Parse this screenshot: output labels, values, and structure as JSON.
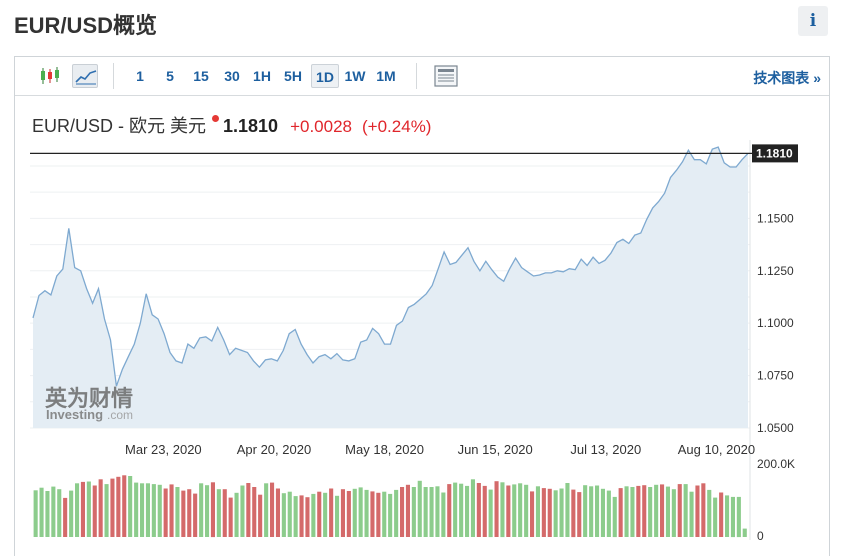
{
  "page": {
    "title": "EUR/USD概览",
    "info_icon": "i"
  },
  "toolbar": {
    "chart_type_icons": [
      "candlestick-icon",
      "line-chart-icon"
    ],
    "timeframes": [
      "1",
      "5",
      "15",
      "30",
      "1H",
      "5H",
      "1D",
      "1W",
      "1M"
    ],
    "active_timeframe": "1D",
    "layout_icon": "layout-icon",
    "tech_link": "技术图表 »"
  },
  "quote": {
    "symbol": "EUR/USD - 欧元 美元",
    "price": "1.1810",
    "change": "+0.0028",
    "change_pct": "(+0.24%)",
    "color_down": "#e0262b"
  },
  "watermark": {
    "cn": "英为财情",
    "en": "Investing",
    "suffix": ".com"
  },
  "chart_data": {
    "type": "area",
    "x_tick_labels": [
      "Mar 23, 2020",
      "Apr 20, 2020",
      "May 18, 2020",
      "Jun 15, 2020",
      "Jul 13, 2020",
      "Aug 10, 2020"
    ],
    "y_tick_labels": [
      "1.1500",
      "1.1250",
      "1.1000",
      "1.0750",
      "1.0500"
    ],
    "ylim": [
      1.05,
      1.185
    ],
    "last_price_label": "1.1810",
    "series_values": [
      1.1025,
      1.1132,
      1.1155,
      1.1135,
      1.1225,
      1.1258,
      1.1452,
      1.1265,
      1.125,
      1.1165,
      1.1095,
      1.1165,
      1.102,
      1.092,
      1.07,
      1.078,
      1.084,
      1.09,
      1.1,
      1.114,
      1.104,
      1.102,
      1.095,
      1.086,
      1.082,
      1.081,
      1.09,
      1.088,
      1.093,
      1.0935,
      1.0915,
      1.098,
      1.092,
      1.085,
      1.088,
      1.087,
      1.086,
      1.082,
      1.079,
      1.0825,
      1.083,
      1.082,
      1.087,
      1.095,
      1.097,
      1.09,
      1.085,
      1.081,
      1.084,
      1.085,
      1.083,
      1.0855,
      1.0825,
      1.082,
      1.083,
      1.091,
      1.092,
      1.0975,
      1.095,
      1.09,
      1.09,
      1.099,
      1.101,
      1.1075,
      1.109,
      1.1115,
      1.114,
      1.118,
      1.126,
      1.134,
      1.128,
      1.129,
      1.1325,
      1.136,
      1.1295,
      1.125,
      1.1295,
      1.1255,
      1.122,
      1.12,
      1.126,
      1.131,
      1.1265,
      1.1245,
      1.1225,
      1.123,
      1.124,
      1.124,
      1.125,
      1.1245,
      1.126,
      1.1255,
      1.1305,
      1.1275,
      1.1315,
      1.1285,
      1.13,
      1.1335,
      1.1385,
      1.14,
      1.138,
      1.142,
      1.143,
      1.1495,
      1.155,
      1.158,
      1.162,
      1.1695,
      1.173,
      1.177,
      1.1825,
      1.178,
      1.178,
      1.176,
      1.183,
      1.184,
      1.1765,
      1.1745,
      1.1745,
      1.178,
      1.181
    ],
    "volume_label": "200.0K",
    "volume_zero_label": "0",
    "volume_max": 200000,
    "volume_values": [
      128000,
      135000,
      126000,
      138000,
      131000,
      107000,
      127000,
      147000,
      151000,
      152000,
      141000,
      158000,
      145000,
      160000,
      165000,
      169000,
      167000,
      149000,
      147000,
      147000,
      145000,
      143000,
      133000,
      144000,
      137000,
      127000,
      131000,
      119000,
      147000,
      142000,
      150000,
      131000,
      131000,
      108000,
      121000,
      141000,
      148000,
      137000,
      116000,
      147000,
      149000,
      133000,
      120000,
      124000,
      112000,
      114000,
      109000,
      118000,
      124000,
      121000,
      133000,
      113000,
      131000,
      126000,
      132000,
      136000,
      129000,
      125000,
      121000,
      124000,
      118000,
      129000,
      137000,
      143000,
      137000,
      154000,
      137000,
      137000,
      139000,
      122000,
      145000,
      149000,
      146000,
      140000,
      158000,
      148000,
      140000,
      130000,
      153000,
      150000,
      141000,
      144000,
      147000,
      143000,
      125000,
      139000,
      134000,
      132000,
      128000,
      133000,
      148000,
      130000,
      123000,
      142000,
      139000,
      141000,
      132000,
      127000,
      110000,
      134000,
      139000,
      137000,
      140000,
      142000,
      137000,
      143000,
      144000,
      138000,
      131000,
      145000,
      145000,
      124000,
      141000,
      147000,
      129000,
      108000,
      122000,
      114000,
      110000,
      110000,
      23000
    ],
    "volume_colors": [
      "#8ccc8c",
      "#d46a6a"
    ],
    "volume_up": [
      1,
      1,
      1,
      1,
      1,
      0,
      1,
      1,
      0,
      1,
      0,
      0,
      1,
      0,
      0,
      0,
      1,
      1,
      1,
      1,
      1,
      1,
      0,
      0,
      1,
      0,
      0,
      0,
      1,
      1,
      0,
      1,
      0,
      0,
      1,
      1,
      0,
      0,
      0,
      1,
      0,
      0,
      1,
      1,
      1,
      0,
      0,
      1,
      0,
      1,
      0,
      1,
      0,
      0,
      1,
      1,
      1,
      0,
      0,
      1,
      1,
      1,
      0,
      0,
      1,
      1,
      1,
      1,
      1,
      1,
      0,
      1,
      1,
      1,
      1,
      0,
      0,
      1,
      0,
      1,
      0,
      1,
      1,
      1,
      0,
      1,
      0,
      0,
      1,
      1,
      1,
      0,
      0,
      1,
      1,
      1,
      1,
      1,
      1,
      0,
      1,
      1,
      0,
      0,
      1,
      1,
      0,
      1,
      1,
      0,
      1,
      1,
      0,
      0,
      1,
      1,
      0,
      1,
      1,
      1,
      1
    ],
    "colors": {
      "line": "#7ea9d0",
      "fill": "#e4edf4",
      "last_line": "#222222",
      "label_bg": "#222222"
    }
  }
}
